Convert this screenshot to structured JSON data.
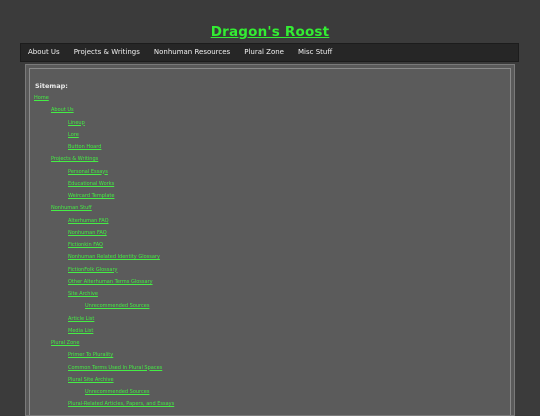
{
  "site": {
    "title": "Dragon's Roost"
  },
  "nav": {
    "items": [
      "About Us",
      "Projects & Writings",
      "Nonhuman Resources",
      "Plural Zone",
      "Misc Stuff"
    ]
  },
  "sitemap": {
    "heading": "Sitemap:",
    "entries": [
      {
        "label": "Home",
        "level": 0
      },
      {
        "label": "About Us",
        "level": 1
      },
      {
        "label": "Lineup",
        "level": 2
      },
      {
        "label": "Lore",
        "level": 2
      },
      {
        "label": "Button Hoard",
        "level": 2
      },
      {
        "label": "Projects & Writings",
        "level": 1
      },
      {
        "label": "Personal Essays",
        "level": 2
      },
      {
        "label": "Educational Works",
        "level": 2
      },
      {
        "label": "Weircard Template",
        "level": 2
      },
      {
        "label": "Nonhuman Stuff",
        "level": 1
      },
      {
        "label": "Alterhuman FAQ",
        "level": 2
      },
      {
        "label": "Nonhuman FAQ",
        "level": 2
      },
      {
        "label": "Fictionkin FAQ",
        "level": 2
      },
      {
        "label": "Nonhuman Related Identity Glossary",
        "level": 2
      },
      {
        "label": "FictionFolk Glossary",
        "level": 2
      },
      {
        "label": "Other Alterhuman Terms Glossary",
        "level": 2
      },
      {
        "label": "Site Archive",
        "level": 2
      },
      {
        "label": "Unrecommended Sources",
        "level": 3
      },
      {
        "label": "Article List",
        "level": 2
      },
      {
        "label": "Media List",
        "level": 2
      },
      {
        "label": "Plural Zone",
        "level": 1
      },
      {
        "label": "Primer To Plurality",
        "level": 2
      },
      {
        "label": "Common Terms Used In Plural Spaces",
        "level": 2
      },
      {
        "label": "Plural Site Archive",
        "level": 2
      },
      {
        "label": "Unrecommended Sources",
        "level": 3
      },
      {
        "label": "Plural-Related Articles, Papers, and Essays",
        "level": 2
      }
    ]
  }
}
